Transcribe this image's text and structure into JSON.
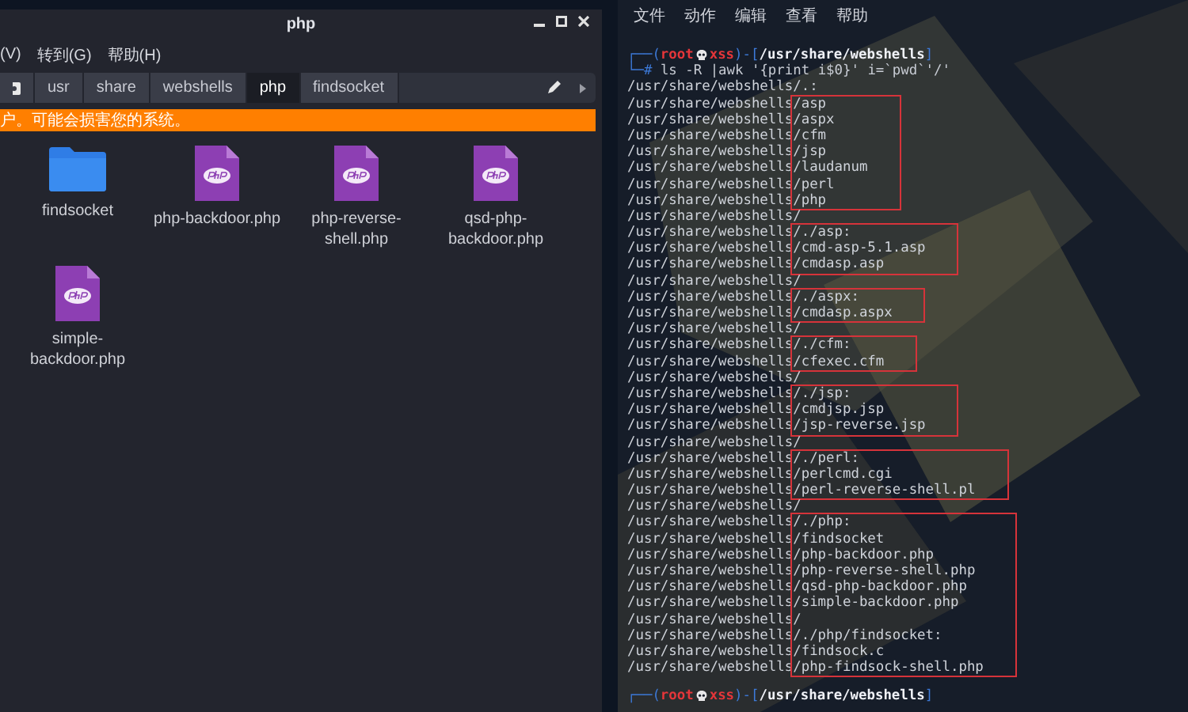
{
  "file_manager": {
    "title": "php",
    "menu": [
      "(V)",
      "转到(G)",
      "帮助(H)"
    ],
    "path": [
      {
        "label": "usr",
        "selected": false
      },
      {
        "label": "share",
        "selected": false
      },
      {
        "label": "webshells",
        "selected": false
      },
      {
        "label": "php",
        "selected": true
      },
      {
        "label": "findsocket",
        "selected": false
      }
    ],
    "warning": "户。可能会损害您的系统。",
    "items": [
      {
        "name": "findsocket",
        "kind": "folder"
      },
      {
        "name": "php-backdoor.php",
        "kind": "php"
      },
      {
        "name": "php-reverse-shell.php",
        "kind": "php"
      },
      {
        "name": "qsd-php-backdoor.php",
        "kind": "php"
      },
      {
        "name": "simple-backdoor.php",
        "kind": "php"
      }
    ]
  },
  "terminal": {
    "menu": [
      "文件",
      "动作",
      "编辑",
      "查看",
      "帮助"
    ],
    "prompt": {
      "open": "┌──(",
      "user": "root",
      "host": "xss",
      "mid": ")-[",
      "cwd": "/usr/share/webshells",
      "close": "]",
      "symbol": "└─#",
      "command": "ls -R |awk '{print i$0}' i=`pwd`'/'"
    },
    "output": [
      {
        "highlighted": false,
        "lines": [
          "/usr/share/webshells/.:"
        ]
      },
      {
        "highlighted": true,
        "lines": [
          "/usr/share/webshells/asp",
          "/usr/share/webshells/aspx",
          "/usr/share/webshells/cfm",
          "/usr/share/webshells/jsp",
          "/usr/share/webshells/laudanum",
          "/usr/share/webshells/perl",
          "/usr/share/webshells/php"
        ]
      },
      {
        "highlighted": false,
        "lines": [
          "/usr/share/webshells/"
        ]
      },
      {
        "highlighted": true,
        "lines": [
          "/usr/share/webshells/./asp:",
          "/usr/share/webshells/cmd-asp-5.1.asp",
          "/usr/share/webshells/cmdasp.asp"
        ]
      },
      {
        "highlighted": false,
        "lines": [
          "/usr/share/webshells/"
        ]
      },
      {
        "highlighted": true,
        "lines": [
          "/usr/share/webshells/./aspx:",
          "/usr/share/webshells/cmdasp.aspx"
        ]
      },
      {
        "highlighted": false,
        "lines": [
          "/usr/share/webshells/"
        ]
      },
      {
        "highlighted": true,
        "lines": [
          "/usr/share/webshells/./cfm:",
          "/usr/share/webshells/cfexec.cfm"
        ]
      },
      {
        "highlighted": false,
        "lines": [
          "/usr/share/webshells/"
        ]
      },
      {
        "highlighted": true,
        "lines": [
          "/usr/share/webshells/./jsp:",
          "/usr/share/webshells/cmdjsp.jsp",
          "/usr/share/webshells/jsp-reverse.jsp"
        ]
      },
      {
        "highlighted": false,
        "lines": [
          "/usr/share/webshells/"
        ]
      },
      {
        "highlighted": true,
        "lines": [
          "/usr/share/webshells/./perl:",
          "/usr/share/webshells/perlcmd.cgi",
          "/usr/share/webshells/perl-reverse-shell.pl"
        ]
      },
      {
        "highlighted": false,
        "lines": [
          "/usr/share/webshells/"
        ]
      },
      {
        "highlighted": true,
        "lines": [
          "/usr/share/webshells/./php:",
          "/usr/share/webshells/findsocket",
          "/usr/share/webshells/php-backdoor.php",
          "/usr/share/webshells/php-reverse-shell.php",
          "/usr/share/webshells/qsd-php-backdoor.php",
          "/usr/share/webshells/simple-backdoor.php",
          "/usr/share/webshells/",
          "/usr/share/webshells/./php/findsocket:",
          "/usr/share/webshells/findsock.c",
          "/usr/share/webshells/php-findsock-shell.php"
        ]
      }
    ],
    "next_prompt": {
      "open": "┌──(",
      "user": "root",
      "host": "xss",
      "mid": ")-[",
      "cwd": "/usr/share/webshells",
      "close": "]"
    }
  }
}
